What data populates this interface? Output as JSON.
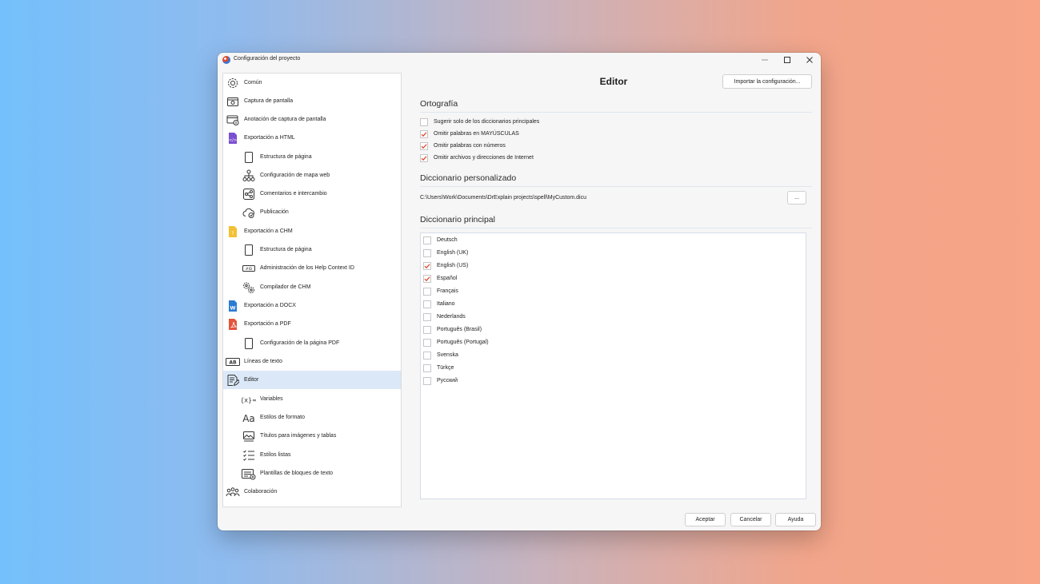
{
  "window": {
    "title": "Configuración del proyecto",
    "controls": [
      "minimize-icon",
      "maximize-icon",
      "close-icon"
    ]
  },
  "sidebar": {
    "items": [
      {
        "label": "Común",
        "icon": "gear-icon",
        "level": 0
      },
      {
        "label": "Captura de pantalla",
        "icon": "screenshot-icon",
        "level": 0
      },
      {
        "label": "Anotación de captura de pantalla",
        "icon": "annotation-icon",
        "level": 0
      },
      {
        "label": "Exportación a HTML",
        "icon": "html-file-icon",
        "level": 0
      },
      {
        "label": "Estructura de página",
        "icon": "page-icon",
        "level": 1
      },
      {
        "label": "Configuración de mapa web",
        "icon": "sitemap-icon",
        "level": 1
      },
      {
        "label": "Comentarios e intercambio",
        "icon": "share-icon",
        "level": 1
      },
      {
        "label": "Publicación",
        "icon": "cloud-icon",
        "level": 1
      },
      {
        "label": "Exportación a CHM",
        "icon": "chm-file-icon",
        "level": 0
      },
      {
        "label": "Estructura de página",
        "icon": "page-icon",
        "level": 1
      },
      {
        "label": "Administración de los Help Context ID",
        "icon": "id-icon",
        "level": 1
      },
      {
        "label": "Compilador de CHM",
        "icon": "gears-icon",
        "level": 1
      },
      {
        "label": "Exportación a DOCX",
        "icon": "docx-file-icon",
        "level": 0
      },
      {
        "label": "Exportación a PDF",
        "icon": "pdf-file-icon",
        "level": 0
      },
      {
        "label": "Configuración de la página PDF",
        "icon": "page-icon",
        "level": 1
      },
      {
        "label": "Líneas de texto",
        "icon": "text-lines-icon",
        "level": 0
      },
      {
        "label": "Editor",
        "icon": "editor-icon",
        "level": 0,
        "selected": true
      },
      {
        "label": "Variables",
        "icon": "variables-icon",
        "level": 1
      },
      {
        "label": "Estilos de formato",
        "icon": "font-style-icon",
        "level": 1
      },
      {
        "label": "Títulos para imágenes y tablas",
        "icon": "image-caption-icon",
        "level": 1
      },
      {
        "label": "Estilos listas",
        "icon": "checklist-icon",
        "level": 1
      },
      {
        "label": "Plantillas de bloques de texto",
        "icon": "template-icon",
        "level": 1
      },
      {
        "label": "Colaboración",
        "icon": "team-icon",
        "level": 0
      }
    ]
  },
  "main": {
    "title": "Editor",
    "import_button": "Importar la configuración...",
    "spelling": {
      "title": "Ortografía",
      "options": [
        {
          "label": "Sugerir solo de los diccionarios principales",
          "checked": false
        },
        {
          "label": "Omitir palabras en MAYÚSCULAS",
          "checked": true
        },
        {
          "label": "Omitir palabras con números",
          "checked": true
        },
        {
          "label": "Omitir archivos y direcciones de Internet",
          "checked": true
        }
      ]
    },
    "custom_dictionary": {
      "title": "Diccionario personalizado",
      "path": "C:\\Users\\Work\\Documents\\DrExplain projects\\spell\\MyCustom.dicu",
      "browse_button": "..."
    },
    "main_dictionary": {
      "title": "Diccionario principal",
      "languages": [
        {
          "label": "Deutsch",
          "checked": false
        },
        {
          "label": "English (UK)",
          "checked": false
        },
        {
          "label": "English (US)",
          "checked": true
        },
        {
          "label": "Español",
          "checked": true
        },
        {
          "label": "Français",
          "checked": false
        },
        {
          "label": "Italiano",
          "checked": false
        },
        {
          "label": "Nederlands",
          "checked": false
        },
        {
          "label": "Português (Brasil)",
          "checked": false
        },
        {
          "label": "Português (Portugal)",
          "checked": false
        },
        {
          "label": "Svenska",
          "checked": false
        },
        {
          "label": "Türkçe",
          "checked": false
        },
        {
          "label": "Русский",
          "checked": false
        }
      ]
    }
  },
  "footer": {
    "accept": "Aceptar",
    "cancel": "Cancelar",
    "help": "Ayuda"
  },
  "colors": {
    "selection": "#dbe8f7",
    "checkmark": "#d9472b",
    "html_icon": "#7b4fd1",
    "chm_icon": "#f2c033",
    "docx_icon": "#2b7cd3",
    "pdf_icon": "#e5533a"
  }
}
